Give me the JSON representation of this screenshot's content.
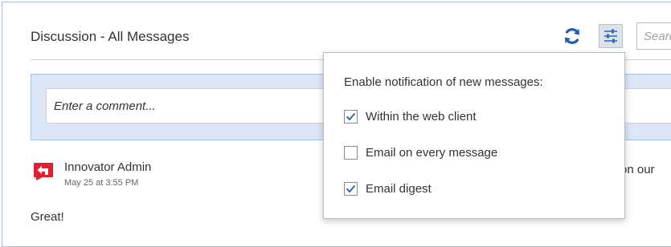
{
  "discussion": {
    "title": "Discussion - All Messages",
    "search_placeholder": "Search",
    "comment_placeholder": "Enter a comment..."
  },
  "toolbar": {
    "refresh_icon": "refresh-icon",
    "settings_icon": "settings-sliders-icon"
  },
  "message": {
    "author": "Innovator Admin",
    "timestamp": "May 25 at 3:55 PM",
    "text": "Great!",
    "overflow_text": "on our",
    "avatar_icon": "reply-arrow-icon"
  },
  "notifications_popup": {
    "heading": "Enable notification of new messages:",
    "options": [
      {
        "label": "Within the web client",
        "checked": true
      },
      {
        "label": "Email on every message",
        "checked": false
      },
      {
        "label": "Email digest",
        "checked": true
      }
    ]
  },
  "colors": {
    "accent_blue": "#1e5fb4",
    "avatar_red": "#e0202f",
    "comment_area_bg": "#dbe7f6",
    "panel_border": "#a9bdd6"
  }
}
